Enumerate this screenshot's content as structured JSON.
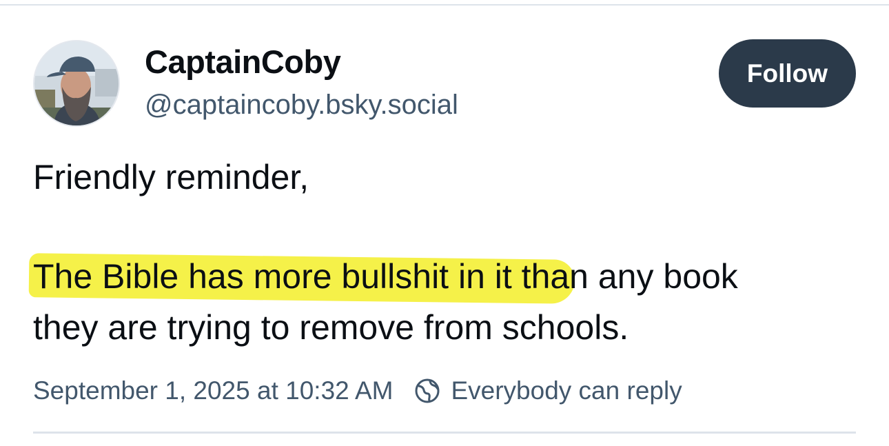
{
  "author": {
    "display_name": "CaptainCoby",
    "handle": "@captaincoby.bsky.social"
  },
  "follow_button": {
    "label": "Follow",
    "color": "#2b3a4a"
  },
  "post": {
    "line_1": "Friendly reminder,",
    "line_2_highlighted": "The Bible has more bullshit in ",
    "line_2_rest": "it than any book",
    "line_3": "they are trying to remove from schools.",
    "highlight_color": "#f4f03a"
  },
  "meta": {
    "timestamp": "September 1, 2025 at 10:32 AM",
    "reply_setting": "Everybody can reply",
    "reply_icon": "globe-icon"
  }
}
